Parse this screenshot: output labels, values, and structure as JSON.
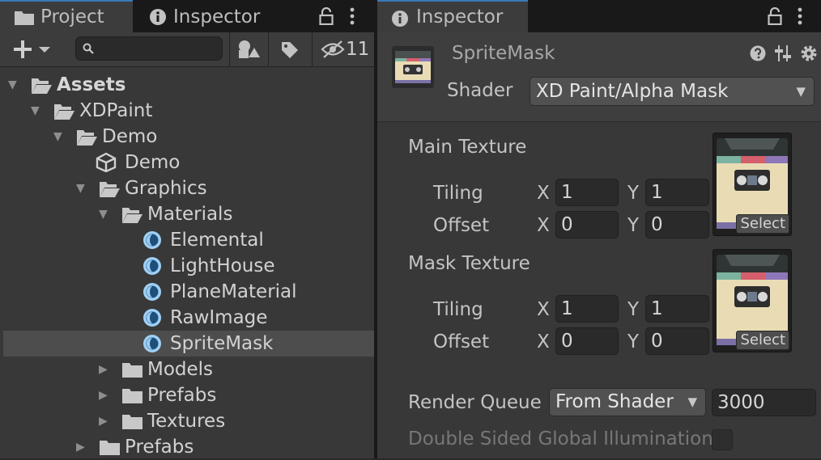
{
  "project_panel": {
    "tabs": [
      {
        "label": "Project",
        "icon": "folder-icon"
      },
      {
        "label": "Inspector",
        "icon": "info-icon"
      }
    ],
    "toolbar": {
      "search_placeholder": "",
      "hidden_count": "11"
    },
    "tree": [
      {
        "label": "Assets",
        "depth": 0,
        "expanded": true,
        "icon": "folder-open-icon",
        "bold": true
      },
      {
        "label": "XDPaint",
        "depth": 1,
        "expanded": true,
        "icon": "folder-open-icon"
      },
      {
        "label": "Demo",
        "depth": 2,
        "expanded": true,
        "icon": "folder-open-icon"
      },
      {
        "label": "Demo",
        "depth": 3,
        "icon": "unity-scene-icon"
      },
      {
        "label": "Graphics",
        "depth": 3,
        "expanded": true,
        "icon": "folder-open-icon"
      },
      {
        "label": "Materials",
        "depth": 4,
        "expanded": true,
        "icon": "folder-open-icon"
      },
      {
        "label": "Elemental",
        "depth": 5,
        "icon": "material-icon"
      },
      {
        "label": "LightHouse",
        "depth": 5,
        "icon": "material-icon"
      },
      {
        "label": "PlaneMaterial",
        "depth": 5,
        "icon": "material-icon"
      },
      {
        "label": "RawImage",
        "depth": 5,
        "icon": "material-icon"
      },
      {
        "label": "SpriteMask",
        "depth": 5,
        "icon": "material-icon",
        "selected": true
      },
      {
        "label": "Models",
        "depth": 4,
        "expanded": false,
        "icon": "folder-icon"
      },
      {
        "label": "Prefabs",
        "depth": 4,
        "expanded": false,
        "icon": "folder-icon"
      },
      {
        "label": "Textures",
        "depth": 4,
        "expanded": false,
        "icon": "folder-icon"
      },
      {
        "label": "Prefabs",
        "depth": 3,
        "expanded": false,
        "icon": "folder-icon"
      }
    ]
  },
  "inspector": {
    "tab_label": "Inspector",
    "material_name": "SpriteMask",
    "shader_label": "Shader",
    "shader_value": "XD Paint/Alpha Mask",
    "main_texture": {
      "title": "Main Texture",
      "tiling_label": "Tiling",
      "offset_label": "Offset",
      "tiling_x": "1",
      "tiling_y": "1",
      "offset_x": "0",
      "offset_y": "0",
      "select_label": "Select"
    },
    "mask_texture": {
      "title": "Mask Texture",
      "tiling_label": "Tiling",
      "offset_label": "Offset",
      "tiling_x": "1",
      "tiling_y": "1",
      "offset_x": "0",
      "offset_y": "0",
      "select_label": "Select"
    },
    "x_label": "X",
    "y_label": "Y",
    "render_queue_label": "Render Queue",
    "render_queue_mode": "From Shader",
    "render_queue_value": "3000",
    "double_sided_label": "Double Sided Global Illumination",
    "double_sided_checked": false
  },
  "colors": {
    "accent": "#3a79bb",
    "selection": "#4d4d4d",
    "material_icon": "#9ed0f5"
  }
}
